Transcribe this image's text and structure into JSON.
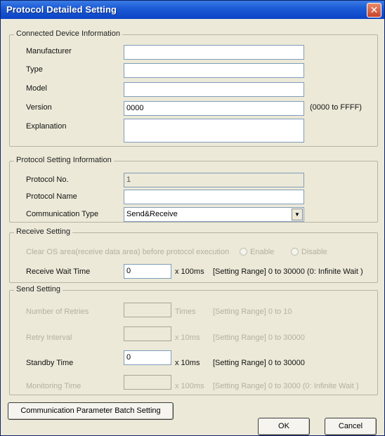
{
  "window": {
    "title": "Protocol Detailed Setting",
    "close_glyph": "✕"
  },
  "device": {
    "legend": "Connected Device Information",
    "manufacturer_label": "Manufacturer",
    "manufacturer_value": "",
    "type_label": "Type",
    "type_value": "",
    "model_label": "Model",
    "model_value": "",
    "version_label": "Version",
    "version_value": "0000",
    "version_range": "(0000 to FFFF)",
    "explanation_label": "Explanation",
    "explanation_value": ""
  },
  "protocol": {
    "legend": "Protocol Setting Information",
    "no_label": "Protocol No.",
    "no_value": "1",
    "name_label": "Protocol Name",
    "name_value": "",
    "comm_type_label": "Communication Type",
    "comm_type_value": "Send&Receive"
  },
  "receive": {
    "legend": "Receive Setting",
    "clear_os_label": "Clear OS area(receive data area) before protocol execution",
    "enable_label": "Enable",
    "disable_label": "Disable",
    "wait_label": "Receive Wait Time",
    "wait_value": "0",
    "wait_unit": "x 100ms",
    "wait_range": "[Setting Range] 0 to 30000 (0: Infinite Wait )"
  },
  "send": {
    "legend": "Send Setting",
    "retries_label": "Number of Retries",
    "retries_value": "",
    "retries_unit": "Times",
    "retries_range": "[Setting Range] 0 to 10",
    "retry_interval_label": "Retry Interval",
    "retry_interval_value": "",
    "retry_interval_unit": "x 10ms",
    "retry_interval_range": "[Setting Range] 0 to 30000",
    "standby_label": "Standby Time",
    "standby_value": "0",
    "standby_unit": "x 10ms",
    "standby_range": "[Setting Range] 0 to 30000",
    "monitoring_label": "Monitoring Time",
    "monitoring_value": "",
    "monitoring_unit": "x 100ms",
    "monitoring_range": "[Setting Range] 0 to 3000 (0: Infinite Wait )"
  },
  "buttons": {
    "batch": "Communication Parameter Batch Setting",
    "ok": "OK",
    "cancel": "Cancel"
  }
}
